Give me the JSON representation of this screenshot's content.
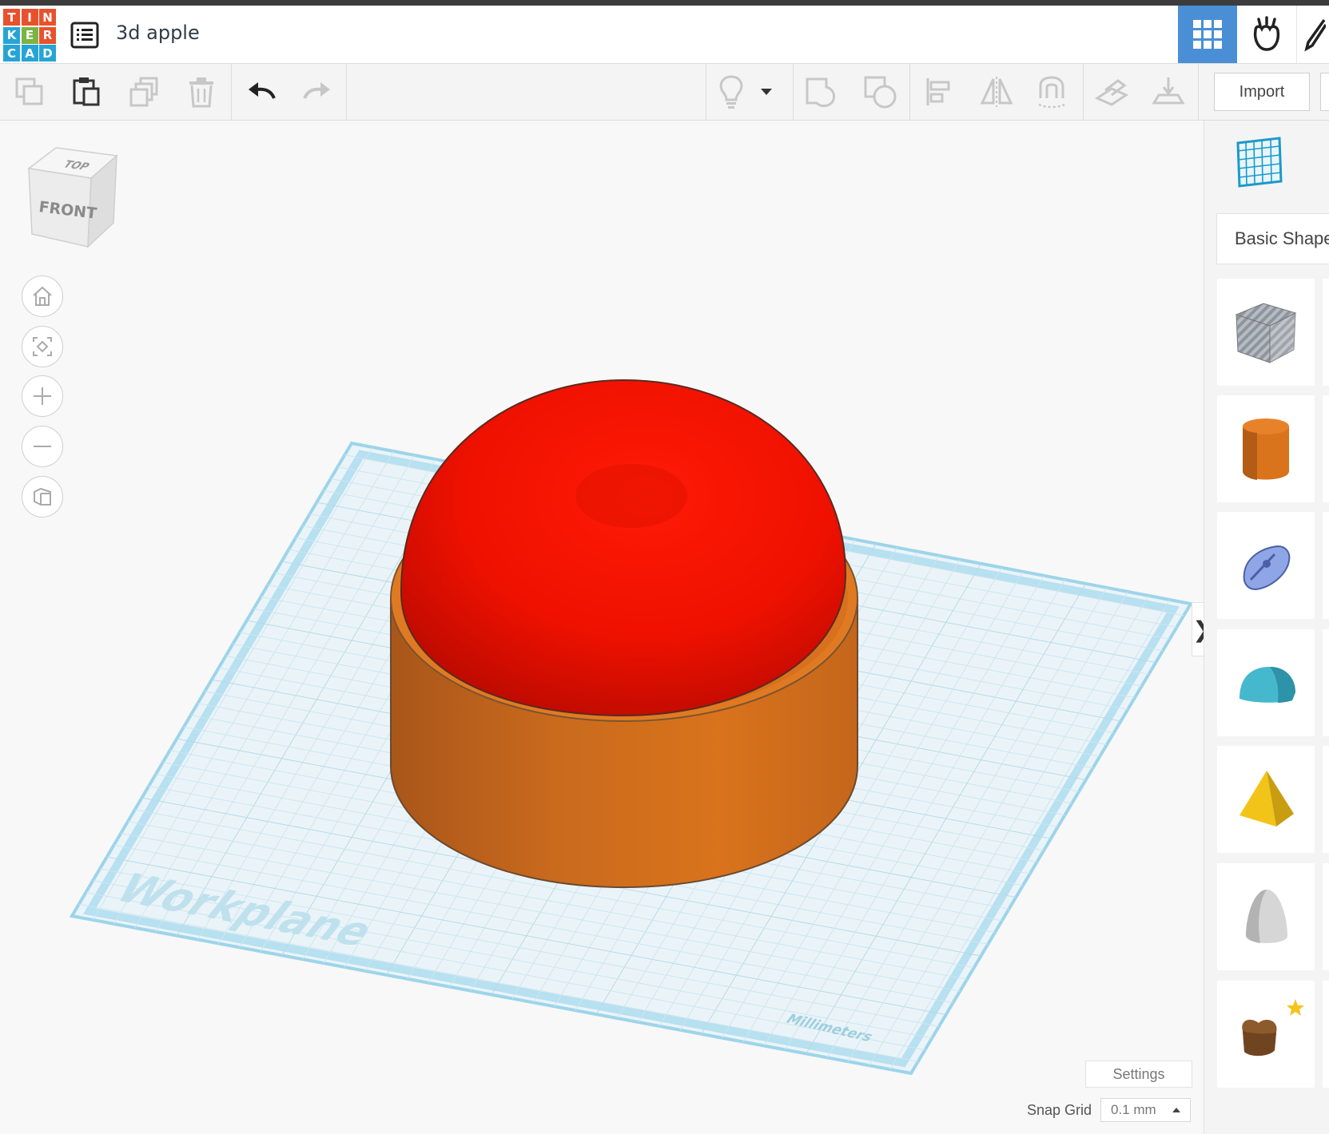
{
  "app": {
    "logo_letters": [
      "T",
      "I",
      "N",
      "K",
      "E",
      "R",
      "C",
      "A",
      "D"
    ],
    "logo_colors": [
      "#e8512d",
      "#e8512d",
      "#e8512d",
      "#27a4d6",
      "#7cb342",
      "#e8512d",
      "#27a4d6",
      "#27a4d6",
      "#27a4d6"
    ],
    "doc_title": "3d apple"
  },
  "header": {
    "view_buttons": [
      "grid-view",
      "tinker-hand",
      "pencil"
    ],
    "active_view": "grid-view",
    "active_color": "#4a8fd6"
  },
  "toolbar": {
    "left_tools": [
      "copy-icon",
      "paste-icon",
      "duplicate-icon",
      "delete-icon",
      "undo-icon",
      "redo-icon"
    ],
    "right_tools": [
      "bulb-icon",
      "dropdown-icon",
      "group-icon",
      "ungroup-icon",
      "align-icon",
      "mirror-icon",
      "cruise-icon",
      "workplane-icon",
      "ruler-icon"
    ],
    "import_label": "Import"
  },
  "viewport": {
    "viewcube_top": "TOP",
    "viewcube_front": "FRONT",
    "nav_buttons": [
      "home-icon",
      "fit-view-icon",
      "zoom-in-icon",
      "zoom-out-icon",
      "projection-icon"
    ],
    "workplane_label": "Workplane",
    "units_label": "Millimeters",
    "settings_label": "Settings",
    "snap_grid_label": "Snap Grid",
    "snap_grid_value": "0.1 mm",
    "collapse_glyph": "❯",
    "objects": [
      {
        "name": "apple-dome",
        "color": "#ee1200"
      },
      {
        "name": "orange-cylinder-base",
        "color": "#d9731c"
      }
    ]
  },
  "panel": {
    "category_label": "Basic Shapes",
    "shapes": [
      {
        "name": "box-hole",
        "color": "#9aa0a8"
      },
      {
        "name": "cylinder",
        "color": "#e07a1f"
      },
      {
        "name": "scribble",
        "color": "#7f9be0"
      },
      {
        "name": "half-round",
        "color": "#41b3c9"
      },
      {
        "name": "pyramid",
        "color": "#f0c419"
      },
      {
        "name": "paraboloid",
        "color": "#c9c9c9"
      },
      {
        "name": "heart",
        "color": "#8d5a2b"
      }
    ]
  }
}
